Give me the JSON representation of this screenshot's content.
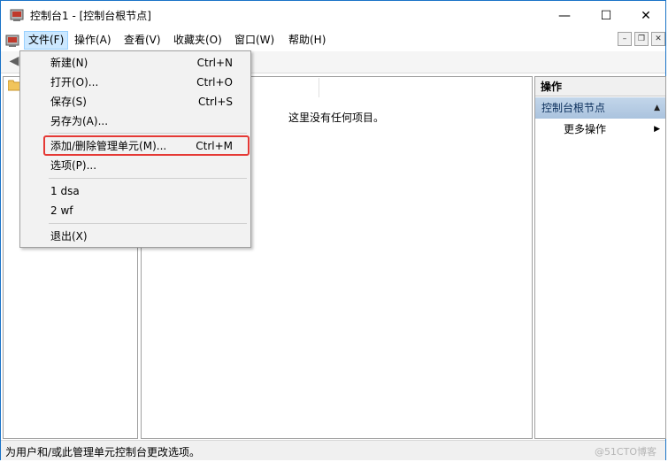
{
  "window": {
    "title": "控制台1 - [控制台根节点]",
    "caption_buttons": {
      "minimize": "—",
      "maximize": "☐",
      "close": "✕"
    }
  },
  "menubar": {
    "items": [
      "文件(F)",
      "操作(A)",
      "查看(V)",
      "收藏夹(O)",
      "窗口(W)",
      "帮助(H)"
    ],
    "mdi_buttons": {
      "minimize": "–",
      "restore": "❐",
      "close": "✕"
    }
  },
  "toolbar": {
    "back": "◀"
  },
  "center": {
    "empty_message": "这里没有任何项目。"
  },
  "actions": {
    "title": "操作",
    "section": "控制台根节点",
    "section_arrow": "▲",
    "more": "更多操作",
    "more_arrow": "▶"
  },
  "file_menu": {
    "items": [
      {
        "label": "新建(N)",
        "shortcut": "Ctrl+N"
      },
      {
        "label": "打开(O)...",
        "shortcut": "Ctrl+O"
      },
      {
        "label": "保存(S)",
        "shortcut": "Ctrl+S"
      },
      {
        "label": "另存为(A)...",
        "shortcut": ""
      },
      {
        "label": "添加/删除管理单元(M)...",
        "shortcut": "Ctrl+M"
      },
      {
        "label": "选项(P)...",
        "shortcut": ""
      },
      {
        "label": "1 dsa",
        "shortcut": ""
      },
      {
        "label": "2 wf",
        "shortcut": ""
      },
      {
        "label": "退出(X)",
        "shortcut": ""
      }
    ]
  },
  "statusbar": {
    "text": "为用户和/或此管理单元控制台更改选项。",
    "watermark": "@51CTO博客"
  },
  "colors": {
    "accent_border": "#1a73c7",
    "menu_highlight": "#cce8ff",
    "annotation_red": "#e53935"
  }
}
